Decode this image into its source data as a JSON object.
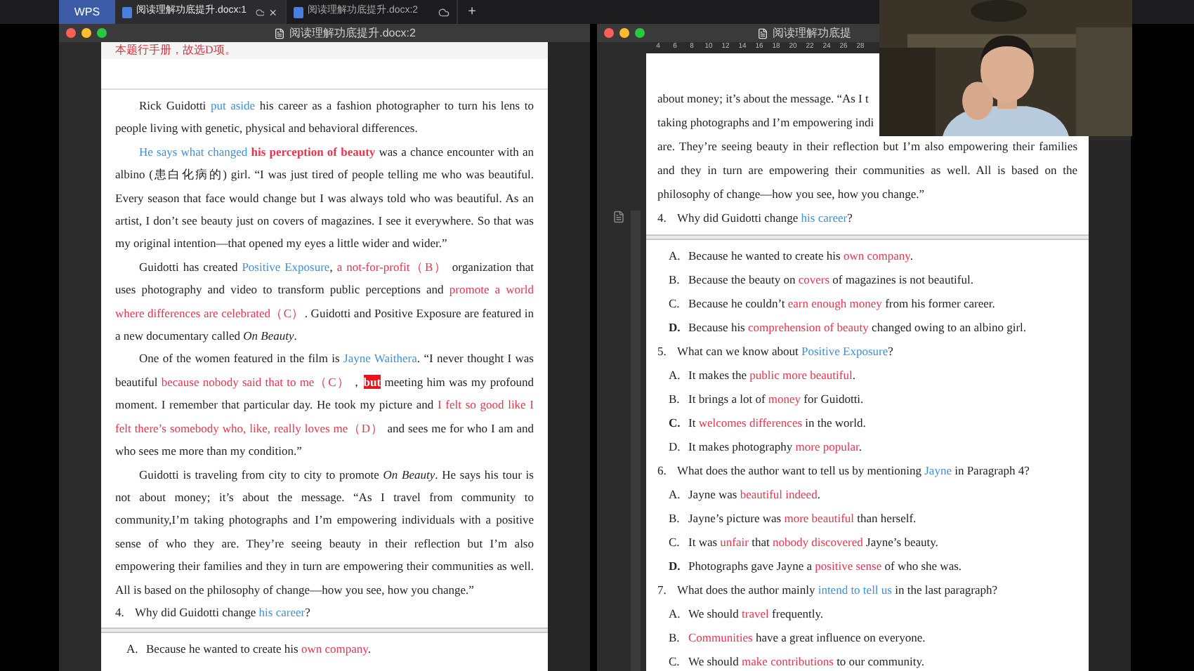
{
  "tab_bar": {
    "app_button": "WPS",
    "tabs": [
      {
        "label": "阅读理解功底提升.docx:1",
        "selected": true,
        "closable": true
      },
      {
        "label": "阅读理解功底提升.docx:2",
        "selected": false,
        "closable": false
      }
    ],
    "new_tab": "+"
  },
  "left_window": {
    "title": "阅读理解功底提升.docx:2",
    "top_note": "本题行手册，故选D项。",
    "blocks": [
      {
        "kind": "para",
        "segments": [
          {
            "kind": "plain",
            "text": "Rick Guidotti "
          },
          {
            "kind": "blue",
            "text": "put aside"
          },
          {
            "kind": "plain",
            "text": " his career as a fashion photographer to turn his lens to people living with genetic, physical and behavioral differences."
          }
        ]
      },
      {
        "kind": "para",
        "segments": [
          {
            "kind": "blue",
            "text": "He says what changed "
          },
          {
            "kind": "bold_red",
            "text": "his perception of beauty"
          },
          {
            "kind": "plain",
            "text": " was a chance encounter with an albino (患白化病的) girl. “I was just tired of people telling me who was beautiful. Every season that face would change but I was always told who was beautiful. As an artist, I don’t see beauty just on covers of magazines. I see it everywhere. So that was my original intention—that opened my eyes a little wider and wider.”"
          }
        ]
      },
      {
        "kind": "para",
        "segments": [
          {
            "kind": "plain",
            "text": "Guidotti has created "
          },
          {
            "kind": "blue",
            "text": "Positive Exposure"
          },
          {
            "kind": "plain",
            "text": ", "
          },
          {
            "kind": "red",
            "text": "a not-for-profit（B）"
          },
          {
            "kind": "plain",
            "text": " organization that uses photography and video to transform public perceptions and "
          },
          {
            "kind": "red",
            "text": "promote a world where differences are celebrated（C）"
          },
          {
            "kind": "plain",
            "text": ". Guidotti and Positive Exposure are featured in a new documentary called "
          },
          {
            "kind": "italic",
            "text": "On Beauty"
          },
          {
            "kind": "plain",
            "text": "."
          }
        ]
      },
      {
        "kind": "para",
        "segments": [
          {
            "kind": "plain",
            "text": "One of the women featured in the film is "
          },
          {
            "kind": "blue",
            "text": "Jayne Waithera"
          },
          {
            "kind": "plain",
            "text": ". “I never thought I was beautiful "
          },
          {
            "kind": "red",
            "text": "because nobody said that to me（C）"
          },
          {
            "kind": "plain",
            "text": "，"
          },
          {
            "kind": "mark",
            "text": "but"
          },
          {
            "kind": "plain",
            "text": " meeting him was my profound moment. I remember that particular day. He took my picture and "
          },
          {
            "kind": "red",
            "text": "I felt so good like I felt there’s somebody who, like, really loves me（D）"
          },
          {
            "kind": "plain",
            "text": " and sees me for who I am and who sees me more than my condition.”"
          }
        ]
      },
      {
        "kind": "para",
        "segments": [
          {
            "kind": "plain",
            "text": "Guidotti is traveling from city to city to promote "
          },
          {
            "kind": "italic",
            "text": "On Beauty"
          },
          {
            "kind": "plain",
            "text": ". He says his tour is not about money; it’s about the message. “As I travel from community to community,I’m taking photographs and I’m empowering individuals with a positive sense of who they are. They’re seeing beauty in their reflection but I’m also empowering their families and they in turn are empowering their communities as well. All is based on the philosophy of change—how you see, how you change.”"
          }
        ]
      },
      {
        "kind": "question",
        "number": "4.",
        "segments": [
          {
            "kind": "plain",
            "text": "Why did Guidotti change "
          },
          {
            "kind": "blue",
            "text": "his career"
          },
          {
            "kind": "plain",
            "text": "?"
          }
        ]
      },
      {
        "kind": "page_break"
      },
      {
        "kind": "option",
        "letter": "A.",
        "bold": false,
        "segments": [
          {
            "kind": "plain",
            "text": "Because he wanted to create his "
          },
          {
            "kind": "red",
            "text": "own company"
          },
          {
            "kind": "plain",
            "text": "."
          }
        ]
      }
    ]
  },
  "right_window": {
    "title": "阅读理解功底提",
    "ruler": [
      "4",
      "6",
      "8",
      "10",
      "12",
      "14",
      "16",
      "18",
      "20",
      "22",
      "24",
      "26",
      "28"
    ],
    "blocks": [
      {
        "kind": "line",
        "segments": [
          {
            "kind": "plain",
            "text": "about money; it’s about the message. “As I t"
          }
        ]
      },
      {
        "kind": "line",
        "segments": [
          {
            "kind": "plain",
            "text": "taking photographs and I’m empowering indi"
          }
        ]
      },
      {
        "kind": "cont",
        "segments": [
          {
            "kind": "plain",
            "text": "are. They’re seeing beauty in their reflection but I’m also empowering their families and they in turn are empowering their communities as well. All is based on the philosophy of change—how you see, how you change.”"
          }
        ]
      },
      {
        "kind": "question",
        "number": "4.",
        "segments": [
          {
            "kind": "plain",
            "text": "Why did Guidotti change "
          },
          {
            "kind": "blue",
            "text": "his career"
          },
          {
            "kind": "plain",
            "text": "?"
          }
        ]
      },
      {
        "kind": "page_break"
      },
      {
        "kind": "option",
        "letter": "A.",
        "bold": false,
        "segments": [
          {
            "kind": "plain",
            "text": "Because he wanted to create his "
          },
          {
            "kind": "red",
            "text": "own company"
          },
          {
            "kind": "plain",
            "text": "."
          }
        ]
      },
      {
        "kind": "option",
        "letter": "B.",
        "bold": false,
        "segments": [
          {
            "kind": "plain",
            "text": "Because the beauty on "
          },
          {
            "kind": "red",
            "text": "covers"
          },
          {
            "kind": "plain",
            "text": " of magazines is not beautiful."
          }
        ]
      },
      {
        "kind": "option",
        "letter": "C.",
        "bold": false,
        "segments": [
          {
            "kind": "plain",
            "text": "Because he couldn’t "
          },
          {
            "kind": "red",
            "text": "earn enough money"
          },
          {
            "kind": "plain",
            "text": " from his former career."
          }
        ]
      },
      {
        "kind": "option",
        "letter": "D.",
        "bold": true,
        "segments": [
          {
            "kind": "plain",
            "text": "Because his "
          },
          {
            "kind": "red",
            "text": "comprehension of beauty"
          },
          {
            "kind": "plain",
            "text": " changed owing to an albino girl."
          }
        ]
      },
      {
        "kind": "question",
        "number": "5.",
        "segments": [
          {
            "kind": "plain",
            "text": "What can we know about "
          },
          {
            "kind": "blue",
            "text": "Positive Exposure"
          },
          {
            "kind": "plain",
            "text": "?"
          }
        ]
      },
      {
        "kind": "option",
        "letter": "A.",
        "bold": false,
        "segments": [
          {
            "kind": "plain",
            "text": "It makes the "
          },
          {
            "kind": "red",
            "text": "public more beautiful"
          },
          {
            "kind": "plain",
            "text": "."
          }
        ]
      },
      {
        "kind": "option",
        "letter": "B.",
        "bold": false,
        "segments": [
          {
            "kind": "plain",
            "text": "It brings a lot of "
          },
          {
            "kind": "red",
            "text": "money"
          },
          {
            "kind": "plain",
            "text": " for Guidotti."
          }
        ]
      },
      {
        "kind": "option",
        "letter": "C.",
        "bold": true,
        "segments": [
          {
            "kind": "plain",
            "text": "It "
          },
          {
            "kind": "red",
            "text": "welcomes differences"
          },
          {
            "kind": "plain",
            "text": " in the world."
          }
        ]
      },
      {
        "kind": "option",
        "letter": "D.",
        "bold": false,
        "segments": [
          {
            "kind": "plain",
            "text": "It makes photography "
          },
          {
            "kind": "red",
            "text": "more popular"
          },
          {
            "kind": "plain",
            "text": "."
          }
        ]
      },
      {
        "kind": "question",
        "number": "6.",
        "segments": [
          {
            "kind": "plain",
            "text": "What does the author want to tell us by mentioning "
          },
          {
            "kind": "blue",
            "text": "Jayne"
          },
          {
            "kind": "plain",
            "text": " in Paragraph 4?"
          }
        ]
      },
      {
        "kind": "option",
        "letter": "A.",
        "bold": false,
        "segments": [
          {
            "kind": "plain",
            "text": "Jayne was "
          },
          {
            "kind": "red",
            "text": "beautiful indeed"
          },
          {
            "kind": "plain",
            "text": "."
          }
        ]
      },
      {
        "kind": "option",
        "letter": "B.",
        "bold": false,
        "segments": [
          {
            "kind": "plain",
            "text": "Jayne’s picture was "
          },
          {
            "kind": "red",
            "text": "more beautiful"
          },
          {
            "kind": "plain",
            "text": " than herself."
          }
        ]
      },
      {
        "kind": "option",
        "letter": "C.",
        "bold": false,
        "segments": [
          {
            "kind": "plain",
            "text": "It was "
          },
          {
            "kind": "red",
            "text": "unfair"
          },
          {
            "kind": "plain",
            "text": " that "
          },
          {
            "kind": "red",
            "text": "nobody discovered"
          },
          {
            "kind": "plain",
            "text": " Jayne’s beauty."
          }
        ]
      },
      {
        "kind": "option",
        "letter": "D.",
        "bold": true,
        "segments": [
          {
            "kind": "plain",
            "text": "Photographs gave Jayne a "
          },
          {
            "kind": "red",
            "text": "positive sense"
          },
          {
            "kind": "plain",
            "text": " of who she was."
          }
        ]
      },
      {
        "kind": "question",
        "number": "7.",
        "segments": [
          {
            "kind": "plain",
            "text": "What does the author mainly "
          },
          {
            "kind": "blue",
            "text": "intend to tell us"
          },
          {
            "kind": "plain",
            "text": " in the last paragraph?"
          }
        ]
      },
      {
        "kind": "option",
        "letter": "A.",
        "bold": false,
        "segments": [
          {
            "kind": "plain",
            "text": "We should "
          },
          {
            "kind": "red",
            "text": "travel"
          },
          {
            "kind": "plain",
            "text": " frequently."
          }
        ]
      },
      {
        "kind": "option",
        "letter": "B.",
        "bold": false,
        "segments": [
          {
            "kind": "red",
            "text": "Communities"
          },
          {
            "kind": "plain",
            "text": " have a great influence on everyone."
          }
        ]
      },
      {
        "kind": "option",
        "letter": "C.",
        "bold": false,
        "segments": [
          {
            "kind": "plain",
            "text": "We should "
          },
          {
            "kind": "red",
            "text": "make contributions"
          },
          {
            "kind": "plain",
            "text": " to our community."
          }
        ]
      }
    ]
  }
}
